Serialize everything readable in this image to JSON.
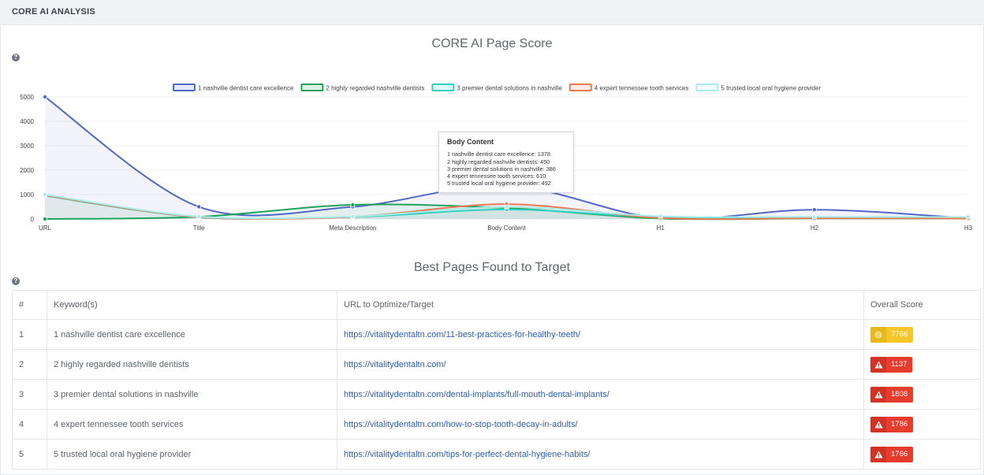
{
  "header": {
    "title": "CORE AI ANALYSIS"
  },
  "help_glyph": "?",
  "chart_section": {
    "title": "CORE AI Page Score"
  },
  "chart_data": {
    "type": "line",
    "categories": [
      "URL",
      "Title",
      "Meta Description",
      "Body Content",
      "H1",
      "H2",
      "H3"
    ],
    "ylim": [
      0,
      5000
    ],
    "yticks": [
      0,
      1000,
      2000,
      3000,
      4000,
      5000
    ],
    "grid": true,
    "legend_position": "top",
    "series": [
      {
        "name": "1 nashville dentist care excellence",
        "color": "#5367c9",
        "values": [
          5000,
          500,
          500,
          1378,
          30,
          380,
          30
        ]
      },
      {
        "name": "2 highly regarded nashville dentists",
        "color": "#1ea35b",
        "values": [
          0,
          90,
          580,
          450,
          20,
          20,
          20
        ]
      },
      {
        "name": "3 premier dental solutions in nashville",
        "color": "#2fd1c0",
        "values": [
          950,
          70,
          80,
          386,
          70,
          60,
          40
        ]
      },
      {
        "name": "4 expert tennessee tooth services",
        "color": "#e77b56",
        "values": [
          970,
          80,
          90,
          610,
          40,
          30,
          20
        ]
      },
      {
        "name": "5 trusted local oral hygiene provider",
        "color": "#a8ecec",
        "values": [
          1000,
          100,
          100,
          492,
          110,
          90,
          80
        ]
      }
    ]
  },
  "tooltip": {
    "title": "Body Content",
    "lines": [
      "1 nashville dentist care excellence: 1378",
      "2 highly regarded nashville dentists: 450",
      "3 premier dental solutions in nashville: 386",
      "4 expert tennessee tooth services: 610",
      "5 trusted local oral hygiene provider: 492"
    ]
  },
  "table_section": {
    "title": "Best Pages Found to Target"
  },
  "table": {
    "headers": {
      "num": "#",
      "keyword": "Keyword(s)",
      "url": "URL to Optimize/Target",
      "score": "Overall Score"
    },
    "rows": [
      {
        "num": "1",
        "keyword": "1 nashville dentist care excellence",
        "url": "https://vitalitydentaltn.com/11-best-practices-for-healthy-teeth/",
        "score": "7766",
        "level": "warning",
        "icon": "circle-exclamation-icon"
      },
      {
        "num": "2",
        "keyword": "2 highly regarded nashville dentists",
        "url": "https://vitalitydentaltn.com/",
        "score": "1137",
        "level": "danger",
        "icon": "warning-triangle-icon"
      },
      {
        "num": "3",
        "keyword": "3 premier dental solutions in nashville",
        "url": "https://vitalitydentaltn.com/dental-implants/full-mouth-dental-implants/",
        "score": "1808",
        "level": "danger",
        "icon": "warning-triangle-icon"
      },
      {
        "num": "4",
        "keyword": "4 expert tennessee tooth services",
        "url": "https://vitalitydentaltn.com/how-to-stop-tooth-decay-in-adults/",
        "score": "1786",
        "level": "danger",
        "icon": "warning-triangle-icon"
      },
      {
        "num": "5",
        "keyword": "5 trusted local oral hygiene provider",
        "url": "https://vitalitydentaltn.com/tips-for-perfect-dental-hygiene-habits/",
        "score": "1766",
        "level": "danger",
        "icon": "warning-triangle-icon"
      }
    ]
  }
}
